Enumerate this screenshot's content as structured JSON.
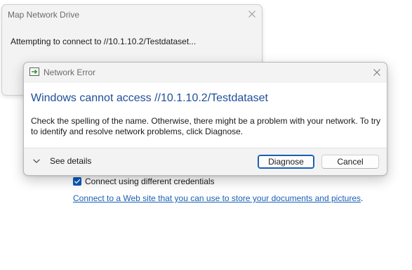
{
  "background_dialog": {
    "title": "Map Network Drive",
    "message": "Attempting to connect to //10.1.10.2/Testdataset..."
  },
  "page": {
    "checkbox_label": "Connect using different credentials",
    "checkbox_checked": true,
    "link_text": "Connect to a Web site that you can use to store your documents and pictures",
    "link_suffix": "."
  },
  "error_dialog": {
    "title": "Network Error",
    "heading": "Windows cannot access //10.1.10.2/Testdataset",
    "body": "Check the spelling of the name. Otherwise, there might be a problem with your network. To try to identify and resolve network problems, click Diagnose.",
    "see_details_label": "See details",
    "diagnose_label": "Diagnose",
    "cancel_label": "Cancel"
  },
  "icons": {
    "app_icon": "network-error-app-icon",
    "close": "close-icon",
    "details_toggle": "chevron-down-icon",
    "check": "checkmark-icon"
  },
  "colors": {
    "heading": "#1f4e9a",
    "link": "#1a60b5",
    "accent": "#0b5ab8",
    "dialog_bg": "#f3f3f3",
    "content_bg": "#ffffff"
  }
}
